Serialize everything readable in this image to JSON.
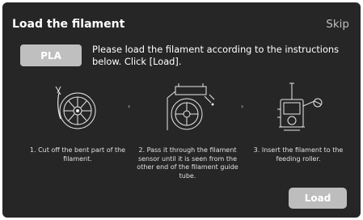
{
  "header": {
    "title": "Load the filament",
    "skip_label": "Skip"
  },
  "material": {
    "label": "PLA"
  },
  "instruction": "Please load the filament according to the instructions below. Click [Load].",
  "steps": [
    {
      "text": "1. Cut off the bent part  of the filament.",
      "icon": "spool-cut-icon"
    },
    {
      "text": "2. Pass it through the filament sensor until it is seen from the other end of the filament guide tube.",
      "icon": "filament-sensor-icon"
    },
    {
      "text": "3. Insert the filament to the feeding roller.",
      "icon": "extruder-feed-icon"
    }
  ],
  "arrows": [
    "›",
    "›"
  ],
  "load_button": {
    "label": "Load"
  },
  "colors": {
    "background": "#262626",
    "button": "#bfbfbf",
    "text": "#ffffff",
    "muted": "#bdbdbd"
  }
}
